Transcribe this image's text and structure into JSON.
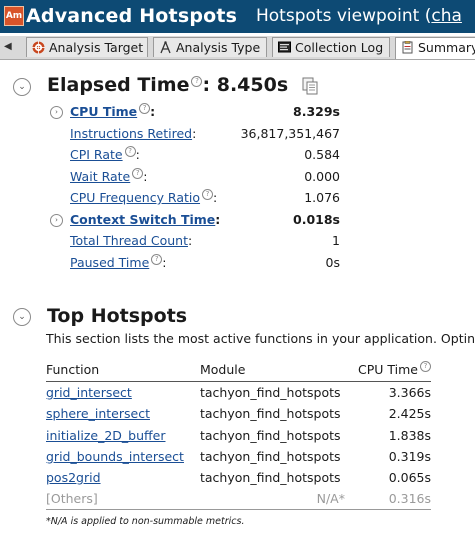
{
  "title_bar": {
    "app_icon_text": "Am",
    "title": "Advanced Hotspots",
    "viewpoint_prefix": "Hotspots viewpoint (",
    "viewpoint_link": "cha"
  },
  "tabs": [
    {
      "label": "Analysis Target",
      "icon": "target-icon"
    },
    {
      "label": "Analysis Type",
      "icon": "analysis-type-icon"
    },
    {
      "label": "Collection Log",
      "icon": "collection-log-icon"
    },
    {
      "label": "Summary",
      "icon": "summary-icon",
      "active": true
    }
  ],
  "elapsed": {
    "label": "Elapsed Time",
    "colon": ":",
    "value": "8.450s",
    "metrics": [
      {
        "label": "CPU Time",
        "colon": ":",
        "value": "8.329s"
      },
      {
        "label": "Instructions Retired",
        "colon": ":",
        "value": "36,817,351,467"
      },
      {
        "label": "CPI Rate",
        "colon": ":",
        "value": "0.584"
      },
      {
        "label": "Wait Rate",
        "colon": ":",
        "value": "0.000"
      },
      {
        "label": "CPU Frequency Ratio",
        "colon": ":",
        "value": "1.076"
      },
      {
        "label": "Context Switch Time",
        "colon": ":",
        "value": "0.018s"
      },
      {
        "label": "Total Thread Count",
        "colon": ":",
        "value": "1"
      },
      {
        "label": "Paused Time",
        "colon": ":",
        "value": "0s"
      }
    ]
  },
  "top_hotspots": {
    "title": "Top Hotspots",
    "description": "This section lists the most active functions in your application. Optin",
    "columns": {
      "function": "Function",
      "module": "Module",
      "cpu_time": "CPU Time"
    },
    "rows": [
      {
        "function": "grid_intersect",
        "module": "tachyon_find_hotspots",
        "cpu_time": "3.366s"
      },
      {
        "function": "sphere_intersect",
        "module": "tachyon_find_hotspots",
        "cpu_time": "2.425s"
      },
      {
        "function": "initialize_2D_buffer",
        "module": "tachyon_find_hotspots",
        "cpu_time": "1.838s"
      },
      {
        "function": "grid_bounds_intersect",
        "module": "tachyon_find_hotspots",
        "cpu_time": "0.319s"
      },
      {
        "function": "pos2grid",
        "module": "tachyon_find_hotspots",
        "cpu_time": "0.065s"
      }
    ],
    "others": {
      "function": "[Others]",
      "module": "N/A*",
      "cpu_time": "0.316s"
    },
    "footnote": "*N/A is applied to non-summable metrics."
  },
  "help_glyph": "?",
  "collapse_glyph": "⌄",
  "expand_glyph": "›"
}
